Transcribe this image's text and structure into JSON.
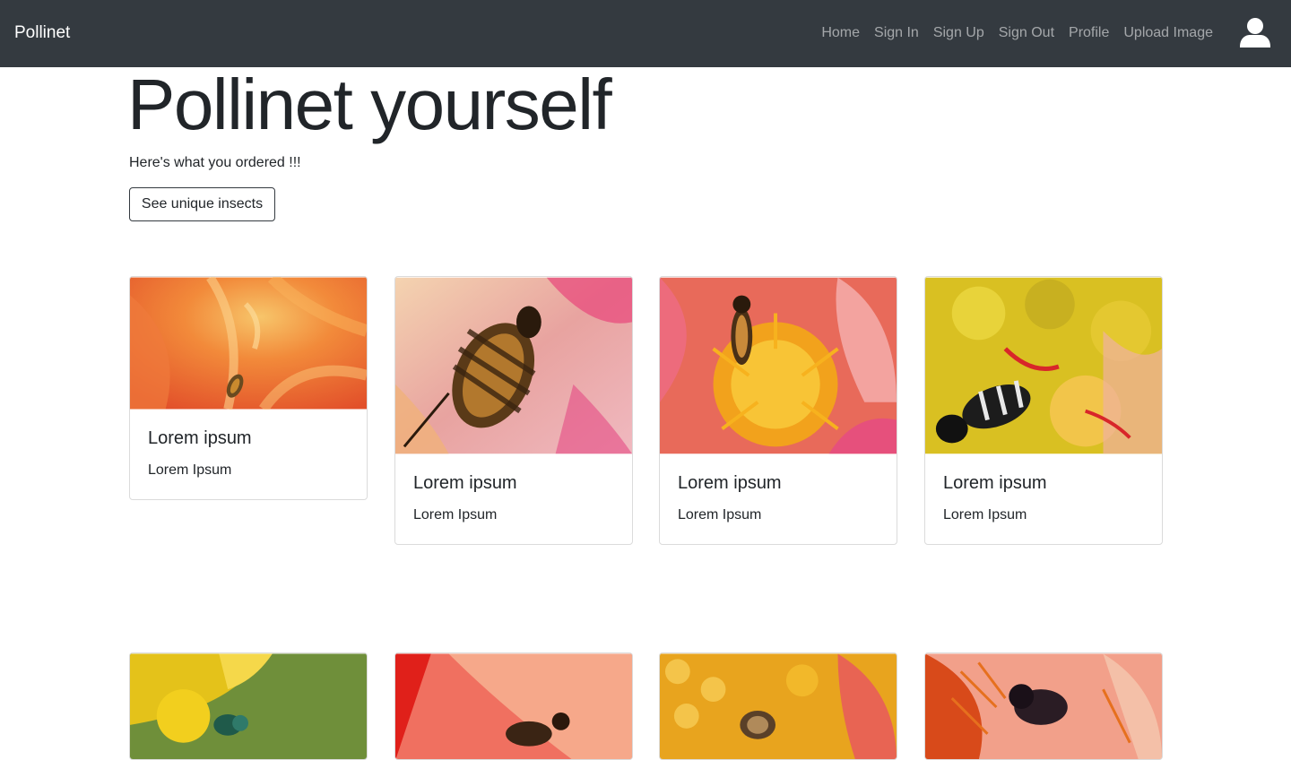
{
  "navbar": {
    "brand": "Pollinet",
    "links": [
      {
        "label": "Home"
      },
      {
        "label": "Sign In"
      },
      {
        "label": "Sign Up"
      },
      {
        "label": "Sign Out"
      },
      {
        "label": "Profile"
      },
      {
        "label": "Upload Image"
      }
    ],
    "user_icon": "user-icon"
  },
  "hero": {
    "title": "Pollinet yourself",
    "subtitle": "Here's what you ordered !!!",
    "button_label": "See unique insects"
  },
  "cards": [
    {
      "title": "Lorem ipsum",
      "text": "Lorem Ipsum",
      "image_desc": "bee on orange dahlia"
    },
    {
      "title": "Lorem ipsum",
      "text": "Lorem Ipsum",
      "image_desc": "bee on pink petals"
    },
    {
      "title": "Lorem ipsum",
      "text": "Lorem Ipsum",
      "image_desc": "bee on yellow stamens"
    },
    {
      "title": "Lorem ipsum",
      "text": "Lorem Ipsum",
      "image_desc": "striped bee on yellow flower"
    },
    {
      "image_desc": "green bee on yellow flower"
    },
    {
      "image_desc": "bee on red petal"
    },
    {
      "image_desc": "bee on yellow stamens"
    },
    {
      "image_desc": "dark bee on orange flower"
    }
  ],
  "colors": {
    "navbar_bg": "#343a40",
    "brand_text": "#ffffff",
    "nav_link_text": "rgba(255,255,255,0.55)",
    "body_text": "#212529"
  }
}
